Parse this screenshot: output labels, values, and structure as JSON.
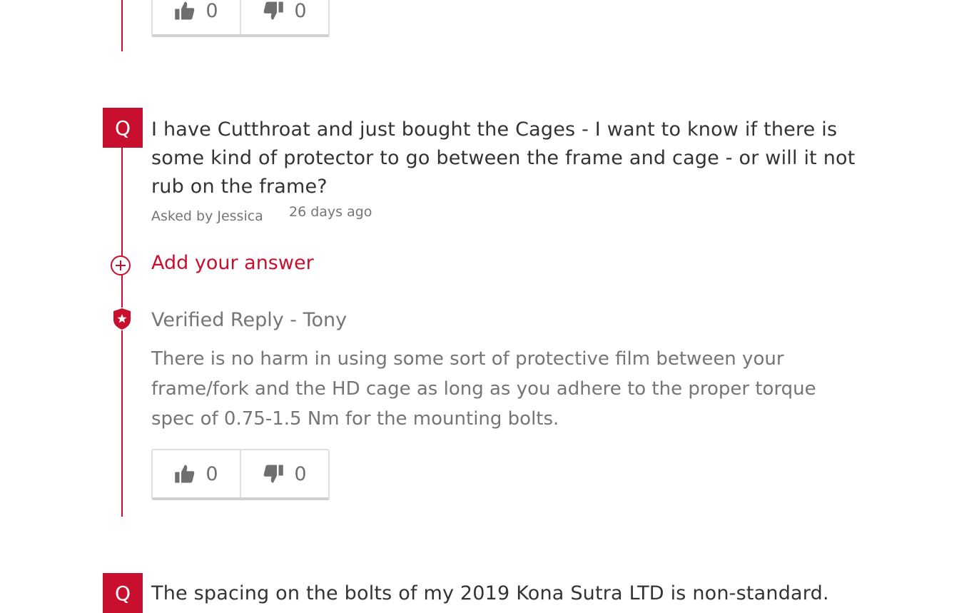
{
  "prev_answer": {
    "upvotes": "0",
    "downvotes": "0"
  },
  "question": {
    "badge": "Q",
    "text": "I have Cutthroat and just bought the Cages - I want to know if there is some kind of protector to go between the frame and cage - or will it not rub on the frame?",
    "asked_by": "Asked by Jessica",
    "time_ago": "26 days ago",
    "add_answer": "Add your answer"
  },
  "reply": {
    "title": "Verified Reply - Tony",
    "body": "There is no harm in using some sort of protective film between your frame/fork and the HD cage as long as you adhere to the proper torque spec of 0.75-1.5 Nm for the mounting bolts.",
    "upvotes": "0",
    "downvotes": "0"
  },
  "next_question": {
    "badge": "Q",
    "text": "The spacing on the bolts of my 2019 Kona Sutra LTD is non-standard."
  },
  "colors": {
    "accent": "#c8102e",
    "muted_text": "#757575",
    "body_text": "#333333"
  },
  "icons": {
    "upvote": "thumbs-up-icon",
    "downvote": "thumbs-down-icon",
    "add": "plus-circle-icon",
    "verified": "shield-star-icon"
  }
}
